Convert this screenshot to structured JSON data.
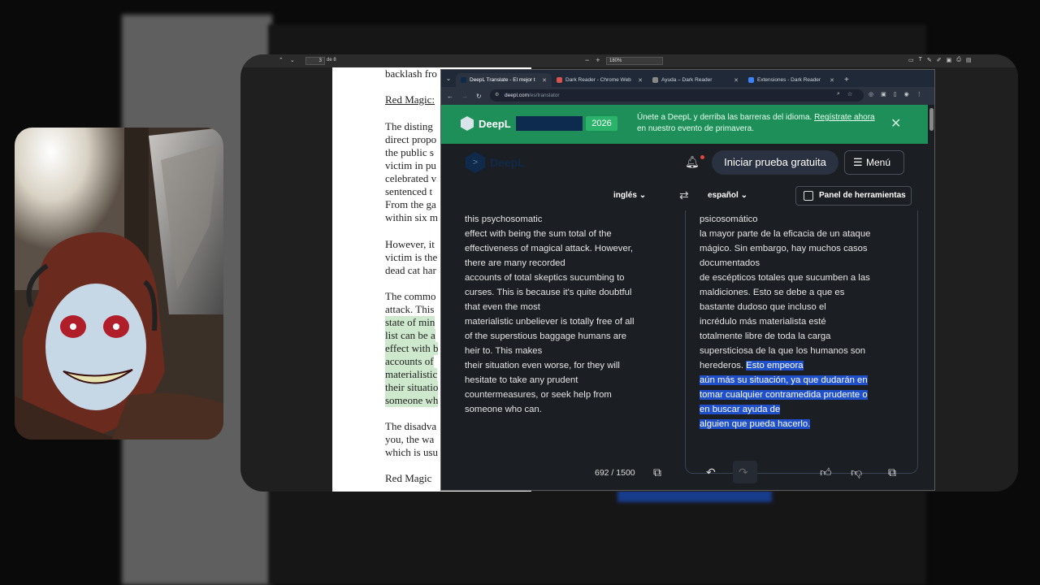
{
  "pdf": {
    "page_current": "3",
    "page_of": "de 8",
    "zoom": "180%",
    "lines": [
      {
        "text": "backlash fro",
        "style": ""
      },
      {
        "text": "Red Magic:",
        "style": "ul"
      },
      {
        "text": "The disting",
        "style": ""
      },
      {
        "text": "direct propo",
        "style": ""
      },
      {
        "text": "the public s",
        "style": ""
      },
      {
        "text": "victim in pu",
        "style": ""
      },
      {
        "text": "celebrated v",
        "style": ""
      },
      {
        "text": "sentenced t",
        "style": ""
      },
      {
        "text": "From the ga",
        "style": ""
      },
      {
        "text": "within six m",
        "style": ""
      },
      {
        "text": "However, it",
        "style": ""
      },
      {
        "text": "victim is the",
        "style": ""
      },
      {
        "text": "dead cat har",
        "style": ""
      },
      {
        "text": "The commo",
        "style": ""
      },
      {
        "text": "attack. This",
        "style": ""
      },
      {
        "text": "state of min",
        "style": "hl"
      },
      {
        "text": "list can be a",
        "style": "hl"
      },
      {
        "text": "effect with b",
        "style": "hl"
      },
      {
        "text": "accounts of",
        "style": "hl"
      },
      {
        "text": "materialistic",
        "style": "hl"
      },
      {
        "text": "their situatio",
        "style": "hl"
      },
      {
        "text": "someone wh",
        "style": "hl"
      },
      {
        "text": "The disadva",
        "style": ""
      },
      {
        "text": "you, the wa",
        "style": ""
      },
      {
        "text": "which is usu",
        "style": ""
      },
      {
        "text": "Red Magic",
        "style": ""
      }
    ]
  },
  "browser": {
    "tabs": [
      {
        "title": "DeepL Translate - El mejor t",
        "active": true,
        "color": "#0f2a4a"
      },
      {
        "title": "Dark Reader - Chrome Web",
        "active": false,
        "color": "#d9534f"
      },
      {
        "title": "Ayuda – Dark Reader",
        "active": false,
        "color": "#888888"
      },
      {
        "title": "Extensiones - Dark Reader",
        "active": false,
        "color": "#3b82f6"
      }
    ],
    "url_host": "deepl.com",
    "url_path": "/es/translator"
  },
  "deepl": {
    "banner": {
      "brand": "DeepL",
      "year": "2026",
      "message": "Únete a DeepL y derriba las barreras del idioma.",
      "link": "Regístrate ahora",
      "message_tail": "en nuestro evento de primavera."
    },
    "header": {
      "logo_text": "DeepL",
      "trial_button": "Iniciar prueba gratuita",
      "menu_button": "Menú"
    },
    "source_lang": "inglés",
    "target_lang": "español",
    "tools_button": "Panel de herramientas",
    "source_lines": [
      "this psychosomatic",
      "effect with being the sum total of the",
      "effectiveness of magical attack. However,",
      "there are many recorded",
      "accounts of total skeptics sucumbing to",
      "curses. This is because it's quite doubtful",
      "that even the most",
      "materialistic unbeliever is totally free of all",
      "of the superstious baggage humans are",
      "heir to. This makes",
      "their situation even worse, for they will",
      "hesitate to take any prudent",
      "countermeasures, or seek help from",
      "someone who can."
    ],
    "target_lines": [
      {
        "text": "psicosomático",
        "sel": ""
      },
      {
        "text": "la mayor parte de la eficacia de un ataque",
        "sel": ""
      },
      {
        "text": "mágico. Sin embargo, hay muchos casos",
        "sel": ""
      },
      {
        "text": "documentados",
        "sel": ""
      },
      {
        "text": "de escépticos totales que sucumben a las",
        "sel": ""
      },
      {
        "text": "maldiciones. Esto se debe a que es",
        "sel": ""
      },
      {
        "text": "bastante dudoso que incluso el",
        "sel": ""
      },
      {
        "text": "incrédulo más materialista esté",
        "sel": ""
      },
      {
        "text": "totalmente libre de toda la carga",
        "sel": ""
      },
      {
        "text": "supersticiosa de la que los humanos son",
        "sel": ""
      },
      {
        "text": "herederos. ",
        "sel": "Esto empeora"
      },
      {
        "text": "",
        "sel": "aún más su situación, ya que dudarán en"
      },
      {
        "text": "",
        "sel": "tomar cualquier contramedida prudente o"
      },
      {
        "text": "",
        "sel": "en buscar ayuda de"
      },
      {
        "text": "",
        "sel": "alguien que pueda hacerlo."
      }
    ],
    "char_count": "692 / 1500"
  }
}
